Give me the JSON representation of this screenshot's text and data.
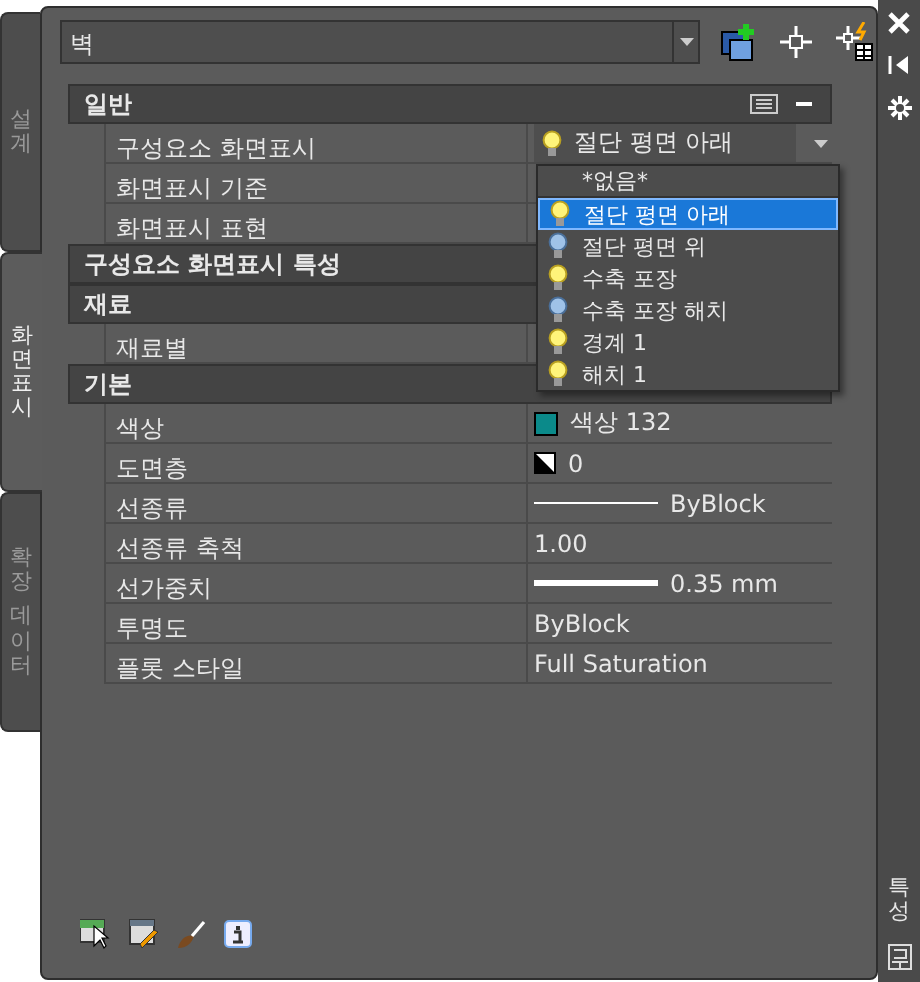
{
  "side_tabs": [
    {
      "label": "설계",
      "selected": false
    },
    {
      "label": "화면표시",
      "selected": true
    },
    {
      "label": "확장 데이터",
      "selected": false
    }
  ],
  "style_combo": {
    "value": "벽"
  },
  "sections": [
    {
      "title": "일반",
      "tools": true,
      "rows": [
        {
          "label": "구성요소 화면표시",
          "kind": "dropdown",
          "value": "절단 평면 아래"
        },
        {
          "label": "화면표시 기준",
          "kind": "text"
        },
        {
          "label": "화면표시 표현",
          "kind": "text"
        }
      ]
    },
    {
      "title": "구성요소 화면표시 특성"
    },
    {
      "title": "재료",
      "rows": [
        {
          "label": "재료별",
          "kind": "text"
        }
      ]
    },
    {
      "title": "기본",
      "rows": [
        {
          "label": "색상",
          "kind": "color",
          "value": "색상 132",
          "color": "#0b8a8a"
        },
        {
          "label": "도면층",
          "kind": "layer",
          "value": "0"
        },
        {
          "label": "선종류",
          "kind": "linetype",
          "value": "ByBlock"
        },
        {
          "label": "선종류 축척",
          "kind": "text",
          "value": "1.00"
        },
        {
          "label": "선가중치",
          "kind": "lineweight",
          "value": "0.35 mm"
        },
        {
          "label": "투명도",
          "kind": "text",
          "value": "ByBlock"
        },
        {
          "label": "플롯 스타일",
          "kind": "text",
          "value": "Full Saturation"
        }
      ]
    }
  ],
  "dropdown_list": [
    {
      "label": "*없음*",
      "kind": "none",
      "selected": false
    },
    {
      "label": "절단 평면 아래",
      "kind": "lit",
      "selected": true
    },
    {
      "label": "절단 평면 위",
      "kind": "unlit",
      "selected": false
    },
    {
      "label": "수축 포장",
      "kind": "lit",
      "selected": false
    },
    {
      "label": "수축 포장 해치",
      "kind": "unlit",
      "selected": false
    },
    {
      "label": "경계 1",
      "kind": "lit",
      "selected": false
    },
    {
      "label": "해치 1",
      "kind": "lit",
      "selected": false
    }
  ],
  "palette_title": "특성"
}
